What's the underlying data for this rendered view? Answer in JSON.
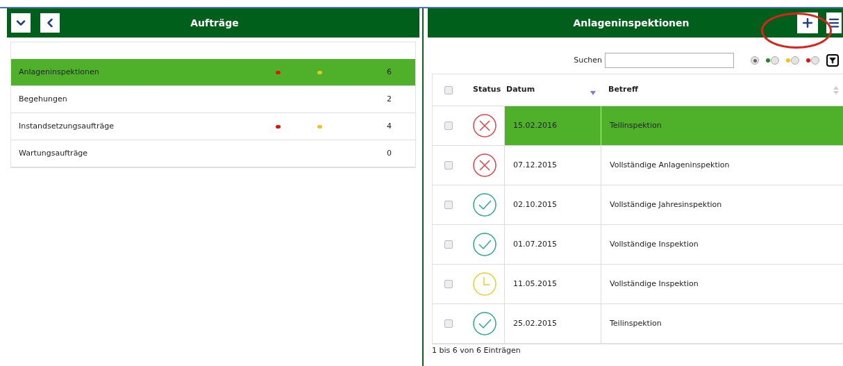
{
  "left_panel": {
    "title": "Aufträge",
    "items": [
      {
        "label": "Anlageninspektionen",
        "count": "6",
        "selected": true,
        "dots": [
          {
            "color": "#e8120c"
          },
          {
            "color": "#f0c419"
          }
        ]
      },
      {
        "label": "Begehungen",
        "count": "2",
        "selected": false
      },
      {
        "label": "Instandsetzungsaufträge",
        "count": "4",
        "selected": false,
        "dots": [
          {
            "color": "#e8120c"
          },
          {
            "color": "#f0c419"
          }
        ]
      },
      {
        "label": "Wartungsaufträge",
        "count": "0",
        "selected": false
      }
    ]
  },
  "right_panel": {
    "title": "Anlageninspektionen",
    "search": {
      "label": "Suchen"
    },
    "filters": [
      {
        "selected": true
      },
      {
        "color": "#1c8a1c",
        "selected": false
      },
      {
        "color": "#f0c419",
        "selected": false
      },
      {
        "color": "#e8120c",
        "selected": false
      }
    ],
    "table": {
      "all_checked": false,
      "columns": [
        "Status",
        "Datum",
        "Betreff"
      ],
      "rows": [
        {
          "kind": "failed",
          "date": "15.02.2016",
          "subject": "Teilinspektion",
          "selected": true,
          "checked": false
        },
        {
          "kind": "failed",
          "date": "07.12.2015",
          "subject": "Vollständige Anlageninspektion",
          "selected": false,
          "checked": false
        },
        {
          "kind": "done",
          "date": "02.10.2015",
          "subject": "Vollständige Jahresinspektion",
          "selected": false,
          "checked": false
        },
        {
          "kind": "done",
          "date": "01.07.2015",
          "subject": "Vollständige Inspektion",
          "selected": false,
          "checked": false
        },
        {
          "kind": "pending",
          "date": "11.05.2015",
          "subject": "Vollständige Inspektion",
          "selected": false,
          "checked": false
        },
        {
          "kind": "done",
          "date": "25.02.2015",
          "subject": "Teilinspektion",
          "selected": false,
          "checked": false
        }
      ]
    },
    "footer": "1 bis 6 von 6 Einträgen"
  }
}
